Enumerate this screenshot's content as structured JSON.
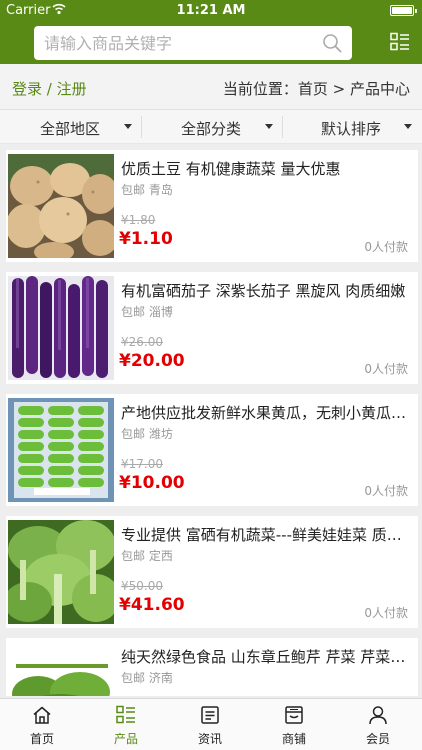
{
  "status_bar": {
    "carrier": "Carrier",
    "time": "11:21 AM"
  },
  "search": {
    "placeholder": "请输入商品关键字"
  },
  "header": {
    "login_label": "登录 / 注册",
    "breadcrumb": "当前位置：首页 > 产品中心"
  },
  "filters": [
    {
      "label": "全部地区"
    },
    {
      "label": "全部分类"
    },
    {
      "label": "默认排序"
    }
  ],
  "products": [
    {
      "title": "优质土豆 有机健康蔬菜 量大优惠",
      "shipping": "包邮",
      "location": "青岛",
      "old_price": "¥1.80",
      "price": "¥1.10",
      "sold": "0人付款",
      "image": "potatoes"
    },
    {
      "title": "有机富硒茄子 深紫长茄子 黑旋风 肉质细嫩",
      "shipping": "包邮",
      "location": "淄博",
      "old_price": "¥26.00",
      "price": "¥20.00",
      "sold": "0人付款",
      "image": "eggplants"
    },
    {
      "title": "产地供应批发新鲜水果黄瓜，无刺小黄瓜旱黄瓜",
      "shipping": "包邮",
      "location": "潍坊",
      "old_price": "¥17.00",
      "price": "¥10.00",
      "sold": "0人付款",
      "image": "cucumbers"
    },
    {
      "title": "专业提供 富硒有机蔬菜---鲜美娃娃菜 质优价廉",
      "shipping": "包邮",
      "location": "定西",
      "old_price": "¥50.00",
      "price": "¥41.60",
      "sold": "0人付款",
      "image": "baby-cabbage"
    },
    {
      "title": "纯天然绿色食品 山东章丘鲍芹 芹菜 芹菜种植",
      "shipping": "包邮",
      "location": "济南",
      "old_price": "",
      "price": "",
      "sold": "",
      "image": "celery"
    }
  ],
  "tabbar": [
    {
      "label": "首页",
      "icon": "home-icon",
      "active": false
    },
    {
      "label": "产品",
      "icon": "list-icon",
      "active": true
    },
    {
      "label": "资讯",
      "icon": "news-icon",
      "active": false
    },
    {
      "label": "商铺",
      "icon": "store-icon",
      "active": false
    },
    {
      "label": "会员",
      "icon": "user-icon",
      "active": false
    }
  ],
  "colors": {
    "brand": "#5a8a16",
    "price": "#e20000"
  }
}
